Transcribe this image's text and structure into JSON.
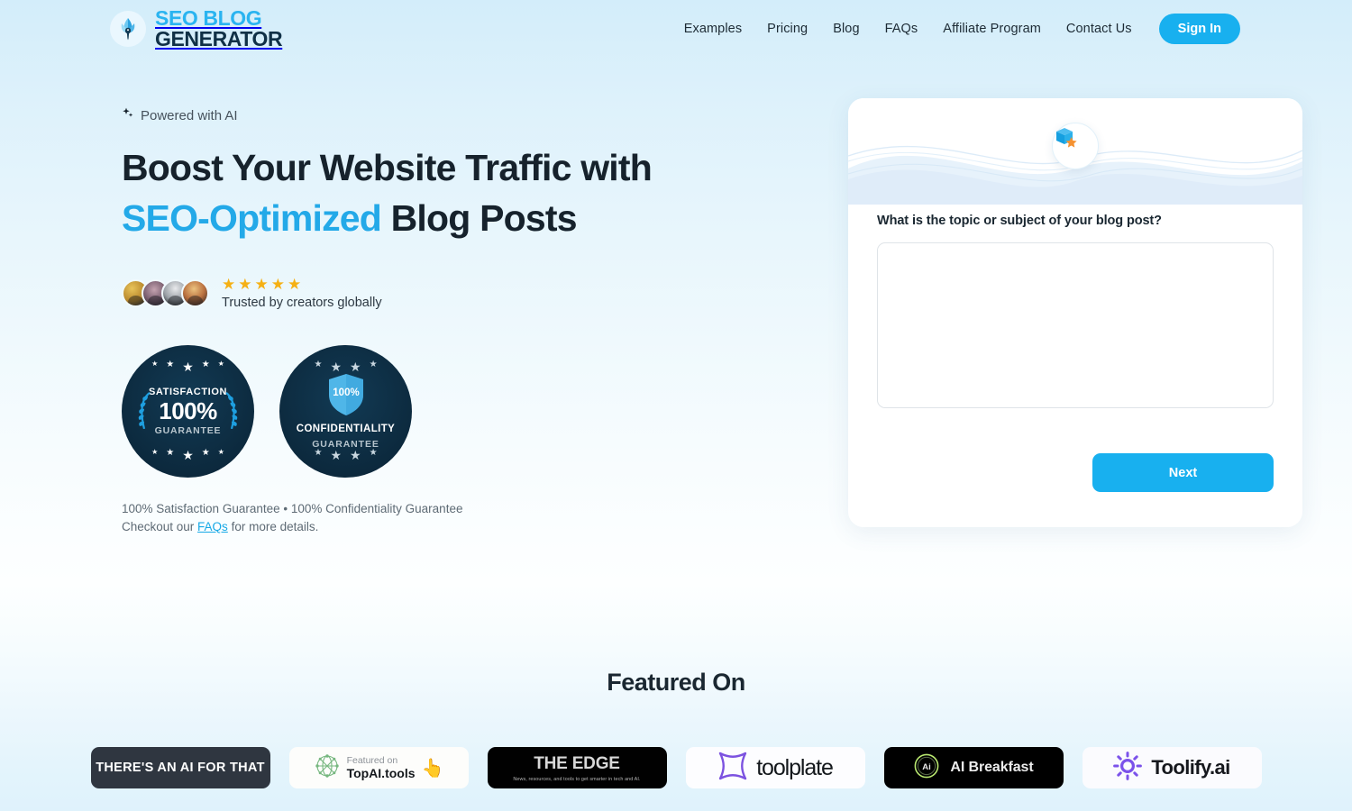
{
  "brand": {
    "line1": "SEO BLOG",
    "line2": "GENERATOR",
    "logo_icon": "feather-pen-icon"
  },
  "nav": {
    "links": [
      {
        "label": "Examples"
      },
      {
        "label": "Pricing"
      },
      {
        "label": "Blog"
      },
      {
        "label": "FAQs"
      },
      {
        "label": "Affiliate Program"
      },
      {
        "label": "Contact Us"
      }
    ],
    "signin_label": "Sign In"
  },
  "hero": {
    "eyebrow": "Powered with AI",
    "headline_part1": "Boost Your Website Traffic with",
    "headline_accent": "SEO-Optimized",
    "headline_part2": " Blog Posts",
    "social_proof": {
      "stars": "★★★★★",
      "trusted_text": "Trusted by creators globally",
      "avatar_count": 4
    },
    "badges": [
      {
        "title": "SATISFACTION",
        "percent": "100%",
        "sub": "GUARANTEE"
      },
      {
        "shield_percent": "100%",
        "title": "CONFIDENTIALITY",
        "sub": "GUARANTEE"
      }
    ],
    "guarantee_line1": "100% Satisfaction Guarantee • 100% Confidentiality Guarantee",
    "guarantee_line2_prefix": "Checkout our ",
    "guarantee_link": "FAQs",
    "guarantee_line2_suffix": " for more details."
  },
  "form_card": {
    "icon": "box-star-icon",
    "question": "What is the topic or subject of your blog post?",
    "textarea_value": "",
    "textarea_placeholder": "",
    "next_label": "Next"
  },
  "featured": {
    "title": "Featured On",
    "logos": [
      {
        "name": "theres-an-ai-for-that",
        "text": "THERE'S AN AI FOR THAT"
      },
      {
        "name": "topai-tools",
        "small": "Featured on",
        "big": "TopAI.tools"
      },
      {
        "name": "the-edge",
        "text": "THE EDGE",
        "sub": "News, resources, and tools to get smarter in tech and AI."
      },
      {
        "name": "toolplate",
        "text": "toolplate"
      },
      {
        "name": "ai-breakfast",
        "text": "AI Breakfast",
        "badge": "Ai"
      },
      {
        "name": "toolify-ai",
        "text": "Toolify.ai"
      }
    ]
  },
  "colors": {
    "accent_blue": "#18b0ef",
    "brand_dark": "#103046",
    "star_gold": "#f5b014",
    "badge_navy": "#0d2c41",
    "link_blue": "#17a9e6"
  }
}
